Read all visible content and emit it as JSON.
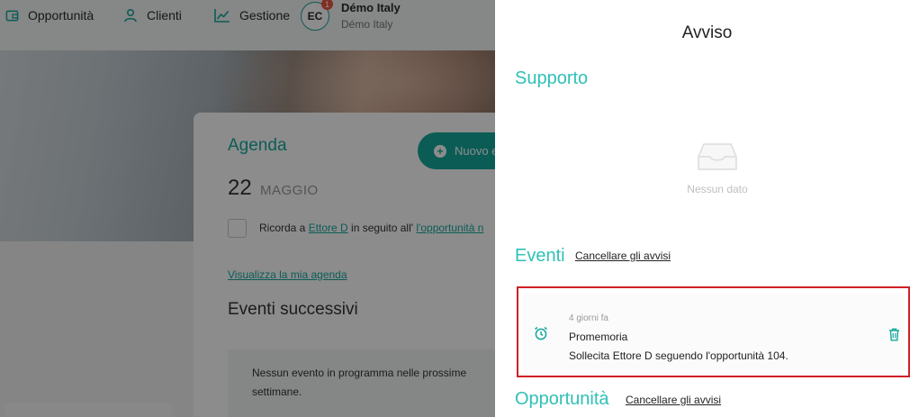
{
  "nav": {
    "items": [
      {
        "label": "Opportunità",
        "icon": "wallet-icon"
      },
      {
        "label": "Clienti",
        "icon": "user-icon"
      },
      {
        "label": "Gestione",
        "icon": "chart-line-icon"
      }
    ],
    "avatar_initials": "EC",
    "badge_count": "1",
    "user_name": "Démo Italy",
    "user_org": "Démo Italy"
  },
  "agenda": {
    "title": "Agenda",
    "new_button": "Nuovo e",
    "date_day": "22",
    "date_month": "MAGGIO",
    "reminder_prefix": "Ricorda a ",
    "reminder_person": "Ettore D",
    "reminder_middle": " in seguito all' ",
    "reminder_link": "l'opportunità n",
    "view_agenda": "Visualizza la mia agenda",
    "events_title": "Eventi successivi",
    "no_events": "Nessun evento in programma nelle prossime settimane."
  },
  "drawer": {
    "title": "Avviso",
    "support_title": "Supporto",
    "no_data": "Nessun dato",
    "events_title": "Eventi",
    "clear_label": "Cancellare gli avvisi",
    "opportunities_title": "Opportunità",
    "clear_label_2": "Cancellare gli avvisi",
    "notification": {
      "time": "4 giorni fa",
      "title": "Promemoria",
      "body": "Sollecita Ettore D seguendo l'opportunità 104."
    }
  },
  "colors": {
    "accent": "#16a89d",
    "section_title": "#2fc1b7",
    "highlight_border": "#d01f26",
    "badge": "#e9573f"
  }
}
